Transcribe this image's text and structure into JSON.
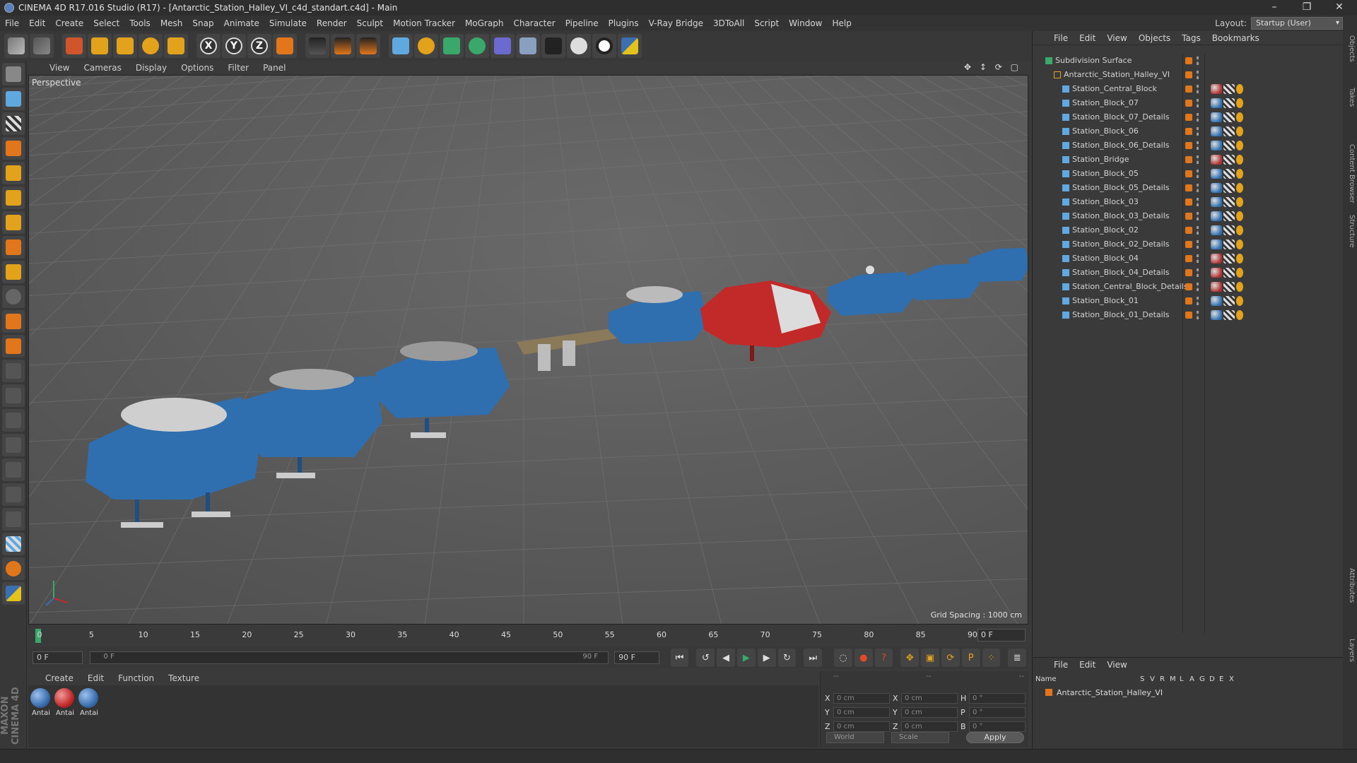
{
  "window": {
    "title": "CINEMA 4D R17.016 Studio (R17) - [Antarctic_Station_Halley_VI_c4d_standart.c4d] - Main",
    "minimize": "–",
    "maximize": "❐",
    "close": "✕"
  },
  "menubar": [
    "File",
    "Edit",
    "Create",
    "Select",
    "Tools",
    "Mesh",
    "Snap",
    "Animate",
    "Simulate",
    "Render",
    "Sculpt",
    "Motion Tracker",
    "MoGraph",
    "Character",
    "Pipeline",
    "Plugins",
    "V-Ray Bridge",
    "3DToAll",
    "Script",
    "Window",
    "Help"
  ],
  "layout": {
    "label": "Layout:",
    "value": "Startup (User)"
  },
  "toolbar_icons": [
    "undo-icon",
    "redo-icon",
    "live-selection-icon",
    "move-icon",
    "scale-icon",
    "rotate-icon",
    "transform-icon",
    "x-axis-lock",
    "y-axis-lock",
    "z-axis-lock",
    "world-coordinates-icon",
    "render-view-icon",
    "render-picture-viewer-icon",
    "edit-render-settings-icon",
    "cube-icon",
    "pen-spline-icon",
    "subdivision-icon",
    "cloner-icon",
    "deformer-icon",
    "floor-icon",
    "camera-icon",
    "light-icon",
    "c4d-logo-icon",
    "python-icon"
  ],
  "axis_labels": [
    "X",
    "Y",
    "Z"
  ],
  "viewport": {
    "menu": [
      "View",
      "Cameras",
      "Display",
      "Options",
      "Filter",
      "Panel"
    ],
    "label": "Perspective",
    "grid_spacing": "Grid Spacing : 1000 cm",
    "nav_icons": "✥ ↕ ⟳ ▢"
  },
  "timeline": {
    "ticks": [
      "0",
      "5",
      "10",
      "15",
      "20",
      "25",
      "30",
      "35",
      "40",
      "45",
      "50",
      "55",
      "60",
      "65",
      "70",
      "75",
      "80",
      "85",
      "90"
    ],
    "current_frame": "0 F"
  },
  "transport": {
    "start_field": "0 F",
    "range_start": "0 F",
    "range_end": "90 F",
    "end_field": "90 F"
  },
  "material_manager": {
    "menu": [
      "Create",
      "Edit",
      "Function",
      "Texture"
    ],
    "materials": [
      {
        "name": "Antai",
        "color": "#3b6fb0"
      },
      {
        "name": "Antai",
        "color": "#c22a2a"
      },
      {
        "name": "Antai",
        "color": "#3b6fb0"
      }
    ]
  },
  "coordinates": {
    "header": [
      "--",
      "--",
      "--"
    ],
    "rows": [
      {
        "a1": "X",
        "v1": "0 cm",
        "a2": "X",
        "v2": "0 cm",
        "a3": "H",
        "v3": "0 °"
      },
      {
        "a1": "Y",
        "v1": "0 cm",
        "a2": "Y",
        "v2": "0 cm",
        "a3": "P",
        "v3": "0 °"
      },
      {
        "a1": "Z",
        "v1": "0 cm",
        "a2": "Z",
        "v2": "0 cm",
        "a3": "B",
        "v3": "0 °"
      }
    ],
    "world": "World",
    "scale": "Scale",
    "apply": "Apply"
  },
  "object_manager": {
    "menu": [
      "File",
      "Edit",
      "View",
      "Objects",
      "Tags",
      "Bookmarks"
    ],
    "objects": [
      {
        "name": "Subdivision Surface",
        "level": 0,
        "icon": "subdivision",
        "tag": ""
      },
      {
        "name": "Antarctic_Station_Halley_VI",
        "level": 1,
        "icon": "null",
        "tag": ""
      },
      {
        "name": "Station_Central_Block",
        "level": 2,
        "icon": "poly",
        "tag": "#b03030"
      },
      {
        "name": "Station_Block_07",
        "level": 2,
        "icon": "poly",
        "tag": "#2f6fb0"
      },
      {
        "name": "Station_Block_07_Details",
        "level": 2,
        "icon": "poly",
        "tag": "#2f6fb0"
      },
      {
        "name": "Station_Block_06",
        "level": 2,
        "icon": "poly",
        "tag": "#2f6fb0"
      },
      {
        "name": "Station_Block_06_Details",
        "level": 2,
        "icon": "poly",
        "tag": "#2f6fb0"
      },
      {
        "name": "Station_Bridge",
        "level": 2,
        "icon": "poly",
        "tag": "#b03030"
      },
      {
        "name": "Station_Block_05",
        "level": 2,
        "icon": "poly",
        "tag": "#2f6fb0"
      },
      {
        "name": "Station_Block_05_Details",
        "level": 2,
        "icon": "poly",
        "tag": "#2f6fb0"
      },
      {
        "name": "Station_Block_03",
        "level": 2,
        "icon": "poly",
        "tag": "#2f6fb0"
      },
      {
        "name": "Station_Block_03_Details",
        "level": 2,
        "icon": "poly",
        "tag": "#2f6fb0"
      },
      {
        "name": "Station_Block_02",
        "level": 2,
        "icon": "poly",
        "tag": "#2f6fb0"
      },
      {
        "name": "Station_Block_02_Details",
        "level": 2,
        "icon": "poly",
        "tag": "#2f6fb0"
      },
      {
        "name": "Station_Block_04",
        "level": 2,
        "icon": "poly",
        "tag": "#b03030"
      },
      {
        "name": "Station_Block_04_Details",
        "level": 2,
        "icon": "poly",
        "tag": "#b03030"
      },
      {
        "name": "Station_Central_Block_Details",
        "level": 2,
        "icon": "poly",
        "tag": "#b03030"
      },
      {
        "name": "Station_Block_01",
        "level": 2,
        "icon": "poly",
        "tag": "#2f6fb0"
      },
      {
        "name": "Station_Block_01_Details",
        "level": 2,
        "icon": "poly",
        "tag": "#2f6fb0"
      }
    ]
  },
  "layer_manager": {
    "menu": [
      "File",
      "Edit",
      "View"
    ],
    "columns": [
      "Name",
      "S",
      "V",
      "R",
      "M",
      "L",
      "A",
      "G",
      "D",
      "E",
      "X"
    ],
    "layer": "Antarctic_Station_Halley_VI"
  },
  "side_tabs": [
    "Objects",
    "Takes",
    "Content Browser",
    "Structure",
    "Attributes",
    "Layers"
  ],
  "maxon_label": "MAXON CINEMA 4D",
  "colors": {
    "accent_orange": "#e2761b",
    "station_blue": "#2f6fb0",
    "station_red": "#c22a2a",
    "viewport_bg": "#585858"
  }
}
